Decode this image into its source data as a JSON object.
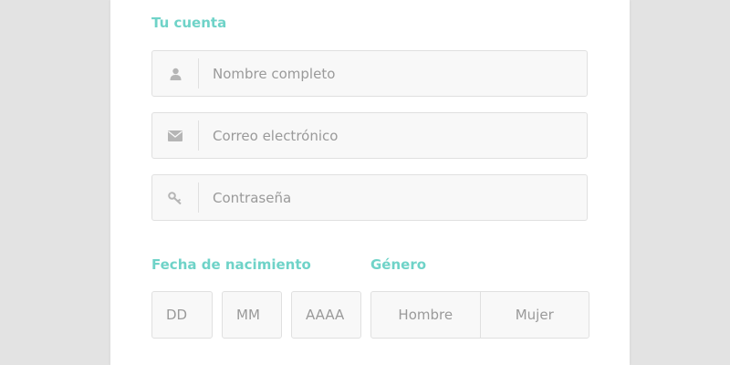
{
  "account": {
    "title": "Tu cuenta",
    "name_placeholder": "Nombre completo",
    "email_placeholder": "Correo electrónico",
    "password_placeholder": "Contraseña"
  },
  "birthdate": {
    "title": "Fecha de nacimiento",
    "day_placeholder": "DD",
    "month_placeholder": "MM",
    "year_placeholder": "AAAA"
  },
  "gender": {
    "title": "Género",
    "options": [
      "Hombre",
      "Mujer"
    ]
  },
  "colors": {
    "accent": "#6fd3c8",
    "page_background": "#e3e3e3",
    "card_background": "#ffffff",
    "field_background": "#f8f8f8",
    "border": "#e0e0e0",
    "icon": "#b5b5b5",
    "placeholder": "#9a9a9a"
  },
  "icons": {
    "name": "user-icon",
    "email": "envelope-icon",
    "password": "key-icon"
  }
}
